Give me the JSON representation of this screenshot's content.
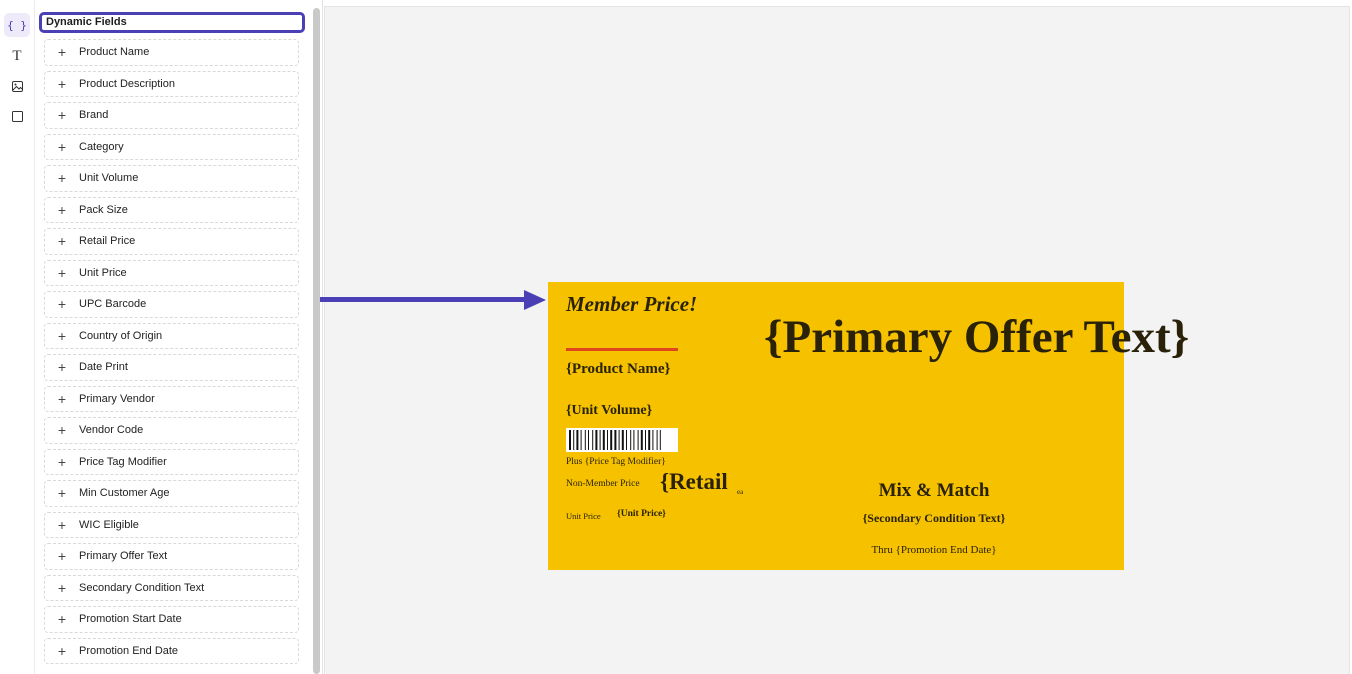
{
  "rail": {
    "items": [
      {
        "name": "dynamic-fields",
        "glyph": "{ }",
        "active": true
      },
      {
        "name": "text",
        "glyph": "T"
      },
      {
        "name": "image"
      },
      {
        "name": "shape"
      }
    ]
  },
  "panel": {
    "title": "Dynamic Fields",
    "add_glyph": "+",
    "fields": [
      "Product Name",
      "Product Description",
      "Brand",
      "Category",
      "Unit Volume",
      "Pack Size",
      "Retail Price",
      "Unit Price",
      "UPC Barcode",
      "Country of Origin",
      "Date Print",
      "Primary Vendor",
      "Vendor Code",
      "Price Tag Modifier",
      "Min Customer Age",
      "WIC Eligible",
      "Primary Offer Text",
      "Secondary Condition Text",
      "Promotion Start Date",
      "Promotion End Date"
    ]
  },
  "tag": {
    "background": "#f6c200",
    "accent_line": "#e0461c",
    "member_price": "Member Price!",
    "product_name": "{Product Name}",
    "unit_volume": "{Unit Volume}",
    "plus_modifier": "Plus {Price Tag Modifier}",
    "non_member_label": "Non-Member Price",
    "retail": "{Retail",
    "ea": "ea",
    "unit_price_label": "Unit Price",
    "unit_price": "{Unit Price}",
    "primary_offer": "{Primary Offer Text}",
    "mix_match": "Mix & Match",
    "secondary_condition": "{Secondary Condition Text}",
    "thru": "Thru {Promotion End Date}"
  },
  "colors": {
    "accent": "#4a3fb5"
  }
}
